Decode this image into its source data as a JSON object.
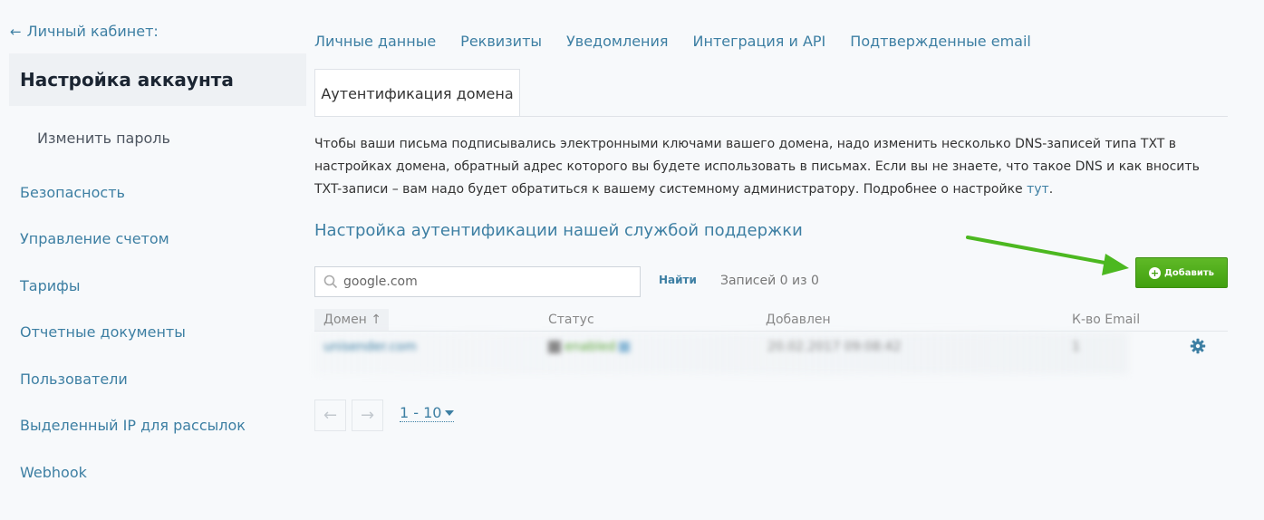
{
  "sidebar": {
    "back_label": "Личный кабинет:",
    "active_title": "Настройка аккаунта",
    "sub_item": "Изменить пароль",
    "items": [
      {
        "label": "Безопасность"
      },
      {
        "label": "Управление счетом"
      },
      {
        "label": "Тарифы"
      },
      {
        "label": "Отчетные документы"
      },
      {
        "label": "Пользователи"
      },
      {
        "label": "Выделенный IP для рассылок"
      },
      {
        "label": "Webhook"
      }
    ]
  },
  "tabs": [
    {
      "label": "Личные данные"
    },
    {
      "label": "Реквизиты"
    },
    {
      "label": "Уведомления"
    },
    {
      "label": "Интеграция и API"
    },
    {
      "label": "Подтвержденные email"
    }
  ],
  "active_tab": "Аутентификация домена",
  "description": {
    "text": "Чтобы ваши письма подписывались электронными ключами вашего домена, надо изменить несколько DNS-записей типа TXT в настройках домена, обратный адрес которого вы будете использовать в письмах. Если вы не знаете, что такое DNS и как вносить TXT-записи – вам надо будет обратиться к вашему системному администратору. Подробнее о настройке ",
    "link": "тут",
    "end": "."
  },
  "section_title": "Настройка аутентификации нашей службой поддержки",
  "search": {
    "placeholder": "google.com",
    "find_label": "Найти",
    "records": "Записей 0 из 0"
  },
  "add_button": "Добавить",
  "table": {
    "headers": [
      "Домен ↑",
      "Статус",
      "Добавлен",
      "К-во Email"
    ],
    "rows": [
      {
        "domain": "unisender.com",
        "status": "enabled",
        "added": "20.02.2017 09:08:42",
        "count": "1"
      }
    ]
  },
  "pagination": {
    "prev": "←",
    "next": "→",
    "page_size": "1 - 10"
  },
  "colors": {
    "link": "#3d7fa3",
    "add_button": "#4caf1a",
    "annotation_arrow": "#4cb820"
  }
}
